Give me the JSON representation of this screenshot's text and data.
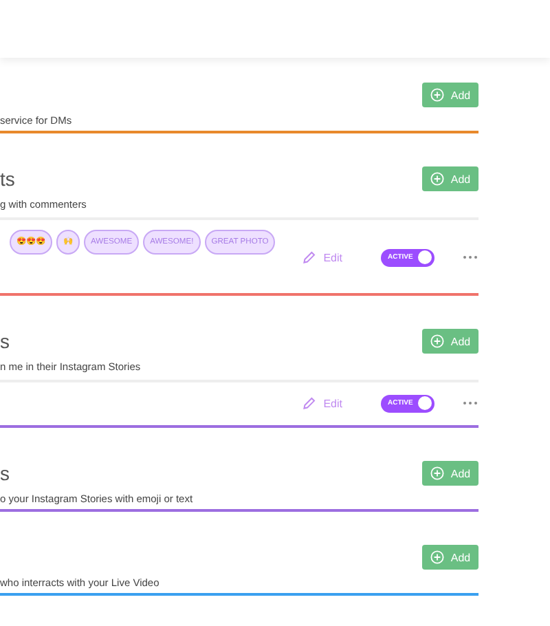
{
  "sections": [
    {
      "description": "service for DMs",
      "add_label": "Add",
      "color": "#e8892c"
    },
    {
      "title": "ts",
      "description": "g with commenters",
      "add_label": "Add",
      "color": "#f0736b",
      "chips": [
        "😍😍😍",
        "🙌",
        "AWESOME",
        "AWESOME!",
        "GREAT PHOTO"
      ],
      "edit_label": "Edit",
      "toggle": {
        "label": "ACTIVE",
        "on": true
      }
    },
    {
      "title": "s",
      "description": "n me in their Instagram Stories",
      "add_label": "Add",
      "color": "#9c6ee0",
      "edit_label": "Edit",
      "toggle": {
        "label": "ACTIVE",
        "on": true
      }
    },
    {
      "title": "s",
      "description": "o your Instagram Stories with emoji or text",
      "add_label": "Add",
      "color": "#9c6ee0"
    },
    {
      "description": "who interracts with your Live Video",
      "add_label": "Add",
      "color": "#3aa0f0"
    }
  ]
}
